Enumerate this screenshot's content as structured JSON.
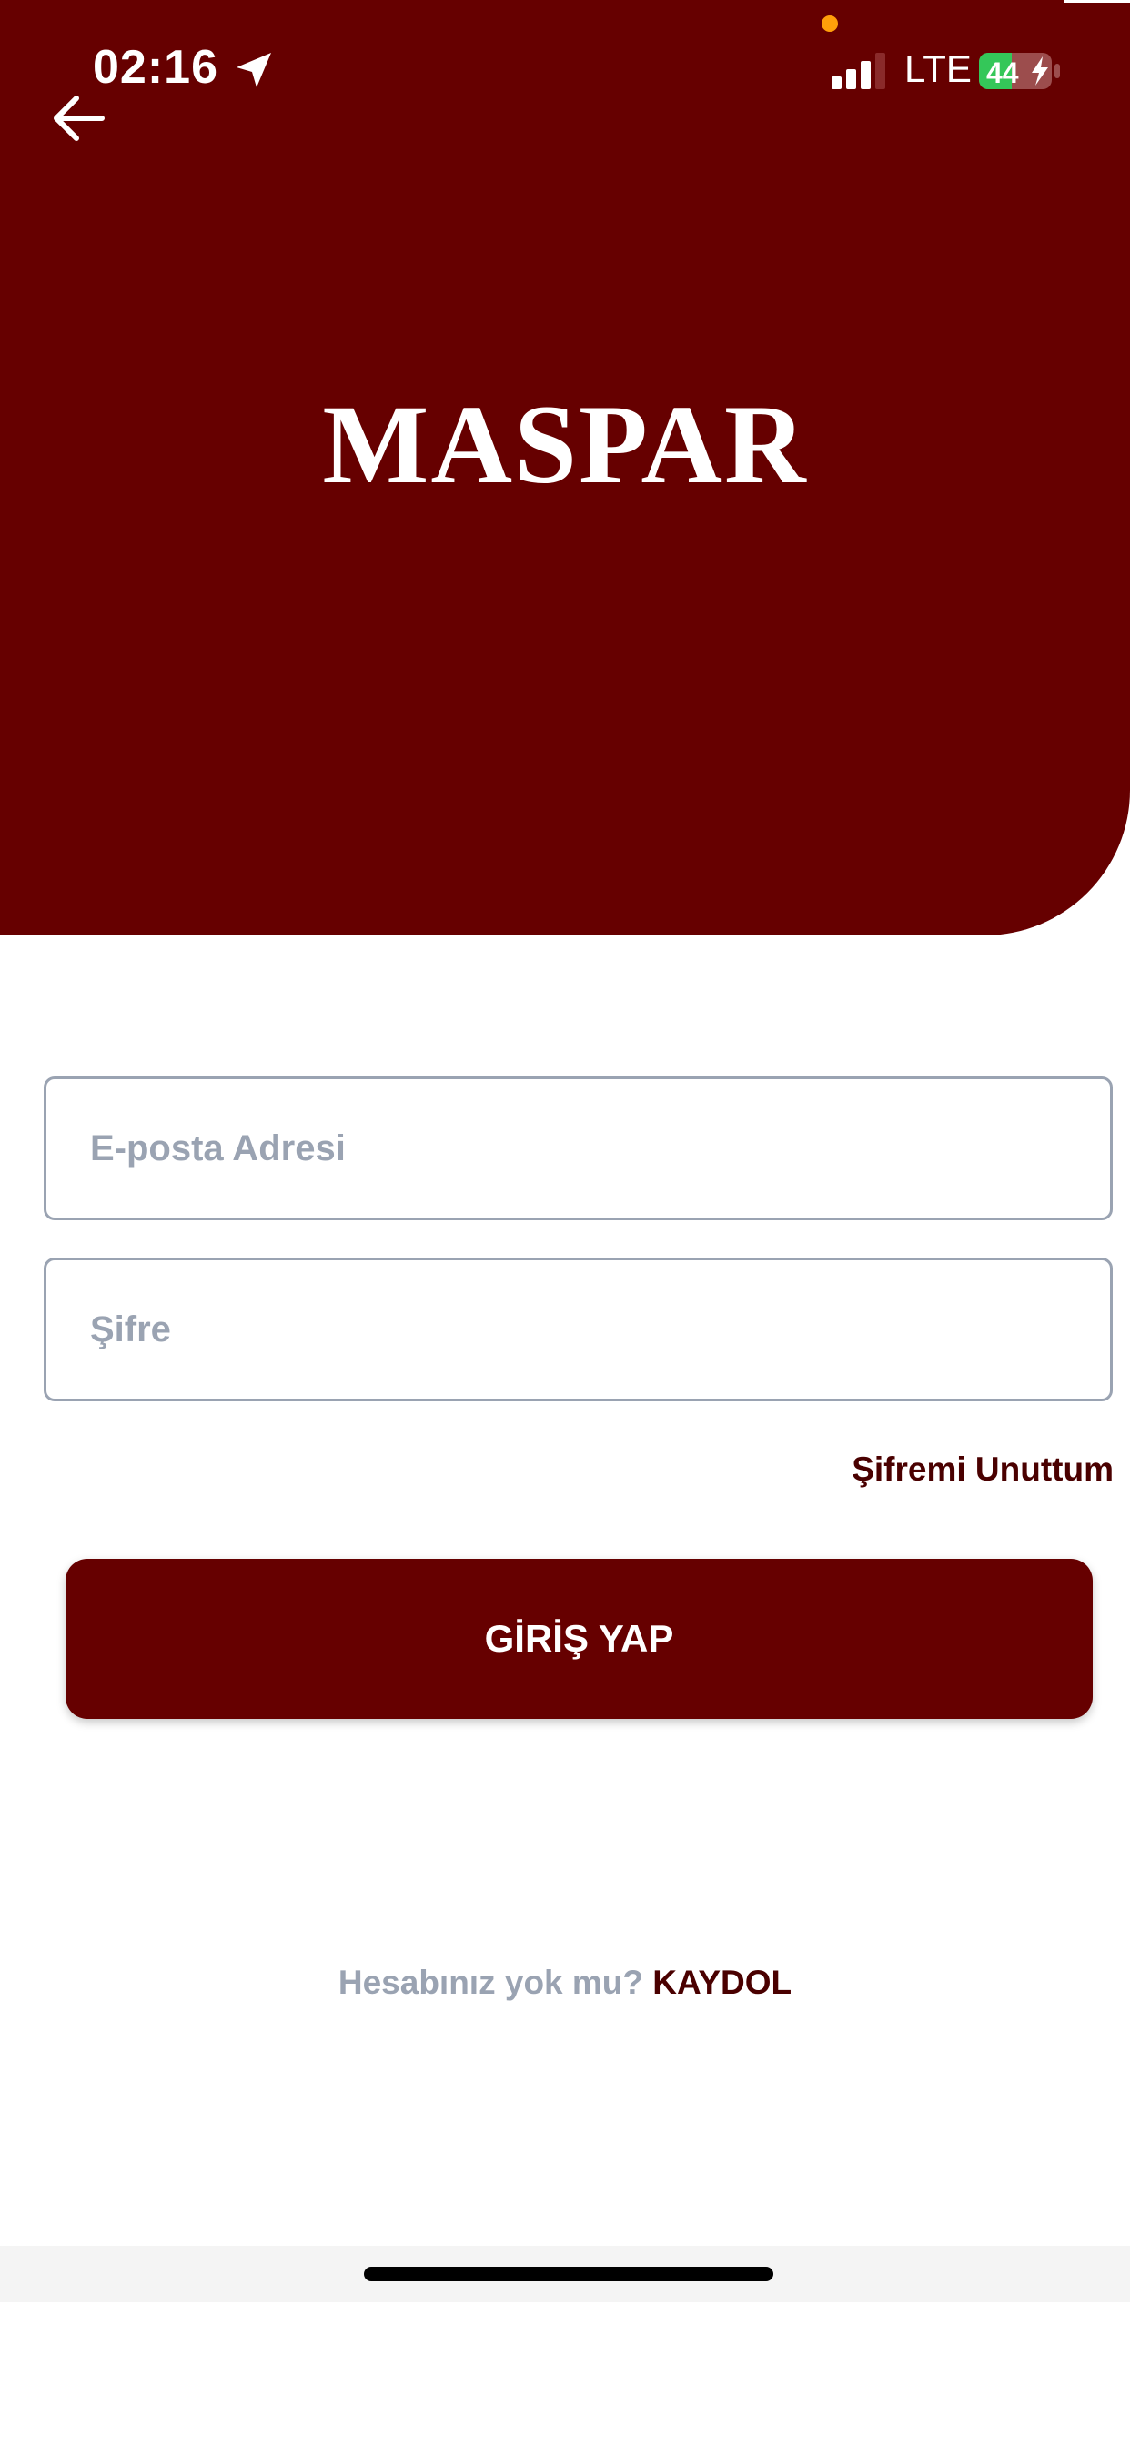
{
  "status_bar": {
    "time": "02:16",
    "network": "LTE",
    "battery_level": "44",
    "icons": [
      "location-arrow-icon",
      "signal-icon",
      "battery-charging-icon"
    ],
    "recording_dot_color": "#ff9f0a"
  },
  "header": {
    "back_icon": "arrow-left-icon",
    "logo_text": "MASPAR",
    "background_color": "#660000"
  },
  "form": {
    "email_placeholder": "E-posta Adresi",
    "email_value": "",
    "password_placeholder": "Şifre",
    "password_value": "",
    "forgot_password_label": "Şifremi Unuttum",
    "login_label": "GİRİŞ YAP"
  },
  "footer": {
    "no_account_text": "Hesabınız yok mu?",
    "signup_label": "KAYDOL"
  },
  "colors": {
    "brand": "#660000",
    "link": "#4a0000",
    "muted": "#9aa3b2"
  }
}
